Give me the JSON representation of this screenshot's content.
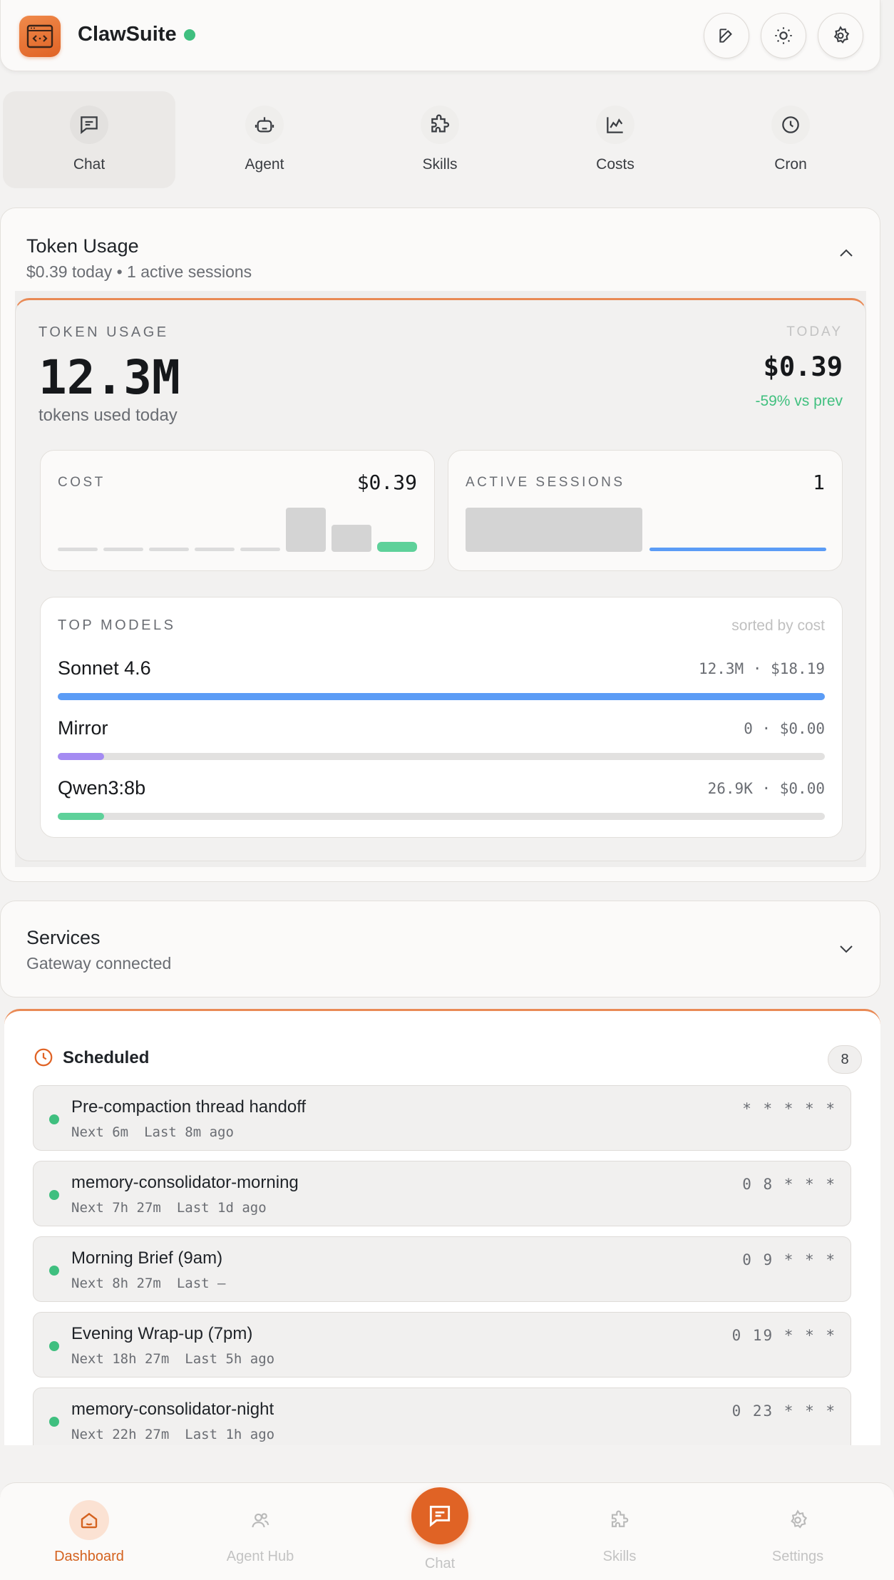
{
  "app": {
    "title": "ClawSuite",
    "status_color": "#3fbf7f"
  },
  "header": {
    "actions": [
      "edit-icon",
      "sun-icon",
      "gear-icon"
    ]
  },
  "quick_nav": [
    {
      "label": "Chat",
      "icon": "chat-icon",
      "active": true
    },
    {
      "label": "Agent",
      "icon": "robot-icon"
    },
    {
      "label": "Skills",
      "icon": "puzzle-icon"
    },
    {
      "label": "Costs",
      "icon": "chart-icon"
    },
    {
      "label": "Cron",
      "icon": "clock-icon"
    }
  ],
  "token_usage_section": {
    "title": "Token Usage",
    "subtitle": "$0.39 today • 1 active sessions",
    "card": {
      "label": "TOKEN USAGE",
      "total": "12.3M",
      "total_sub": "tokens used today",
      "period_label": "TODAY",
      "cost_today": "$0.39",
      "delta": "-59% vs prev",
      "cost_mini": {
        "label": "COST",
        "value": "$0.39"
      },
      "sessions_mini": {
        "label": "ACTIVE SESSIONS",
        "value": "1"
      },
      "top_models": {
        "label": "TOP MODELS",
        "sort_note": "sorted by cost",
        "models": [
          {
            "name": "Sonnet 4.6",
            "meta": "12.3M · $18.19",
            "fraction": 1.0,
            "color": "#5b9cf6"
          },
          {
            "name": "Mirror",
            "meta": "0 · $0.00",
            "fraction": 0.06,
            "color": "#a48bf2"
          },
          {
            "name": "Qwen3:8b",
            "meta": "26.9K · $0.00",
            "fraction": 0.06,
            "color": "#5ed19a"
          }
        ]
      }
    }
  },
  "services_section": {
    "title": "Services",
    "subtitle": "Gateway connected"
  },
  "scheduled": {
    "title": "Scheduled",
    "count": "8",
    "jobs": [
      {
        "name": "Pre-compaction thread handoff",
        "next": "Next 6m",
        "last": "Last 8m ago",
        "cron": "* * * * *"
      },
      {
        "name": "memory-consolidator-morning",
        "next": "Next 7h 27m",
        "last": "Last 1d ago",
        "cron": "0 8 * * *"
      },
      {
        "name": "Morning Brief (9am)",
        "next": "Next 8h 27m",
        "last": "Last —",
        "cron": "0 9 * * *"
      },
      {
        "name": "Evening Wrap-up (7pm)",
        "next": "Next 18h 27m",
        "last": "Last 5h ago",
        "cron": "0 19 * * *"
      },
      {
        "name": "memory-consolidator-night",
        "next": "Next 22h 27m",
        "last": "Last 1h ago",
        "cron": "0 23 * * *"
      }
    ]
  },
  "tabbar": [
    {
      "label": "Dashboard",
      "icon": "home-icon",
      "active": true
    },
    {
      "label": "Agent Hub",
      "icon": "users-icon"
    },
    {
      "label": "Chat",
      "icon": "chat-icon"
    },
    {
      "label": "Skills",
      "icon": "puzzle-icon"
    },
    {
      "label": "Settings",
      "icon": "gear-icon"
    }
  ],
  "colors": {
    "accent": "#e06325",
    "success": "#3fbf7f",
    "sessions_bar": "#5b9cf6"
  }
}
